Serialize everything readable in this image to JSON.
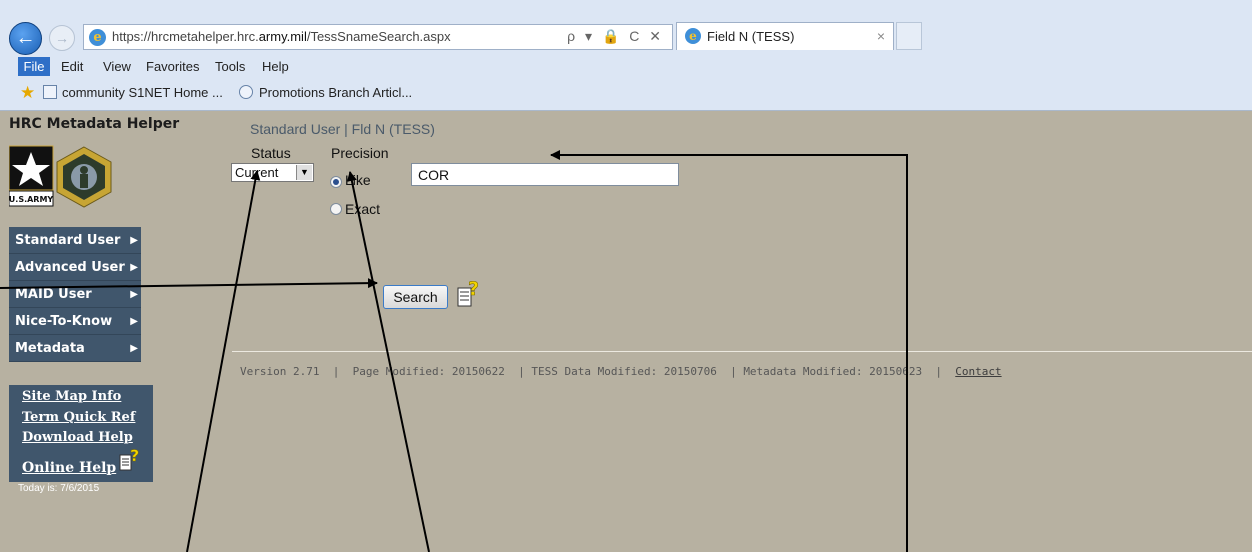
{
  "browser": {
    "url_prefix": "https://hrcmetahelper.hrc.",
    "url_domain": "army.mil",
    "url_suffix": "/TessSnameSearch.aspx",
    "addr_tools": "ρ ▾ 🔒 C ✕",
    "tab_title": "Field N (TESS)",
    "tab_close": "×",
    "menu": [
      "File",
      "Edit",
      "View",
      "Favorites",
      "Tools",
      "Help"
    ],
    "favorites": [
      "community S1NET Home ...",
      "Promotions Branch Articl..."
    ]
  },
  "page": {
    "site_title": "HRC Metadata Helper",
    "logo_text": "U.S.ARMY",
    "user_title": "Standard User | Fld N (TESS)",
    "nav": [
      "Standard User",
      "Advanced User",
      "MAID User",
      "Nice-To-Know",
      "Metadata"
    ],
    "help_links": [
      "Site Map Info",
      "Term Quick Ref",
      "Download Help",
      "Online Help"
    ],
    "today": "Today is: 7/6/2015",
    "form": {
      "status_label": "Status",
      "precision_label": "Precision",
      "status_value": "Current",
      "like_label": "Like",
      "exact_label": "Exact",
      "selected_precision": "Like",
      "term_value": "COR",
      "search_label": "Search"
    },
    "footer": {
      "text": "Version 2.71  |  Page Modified: 20150622  | TESS Data Modified: 20150706  | Metadata Modified: 20150623  |  ",
      "contact": "Contact"
    }
  },
  "colors": {
    "page_bg": "#b7b1a1",
    "nav_bg": "#40566c",
    "chrome_bg": "#dce6f4"
  }
}
